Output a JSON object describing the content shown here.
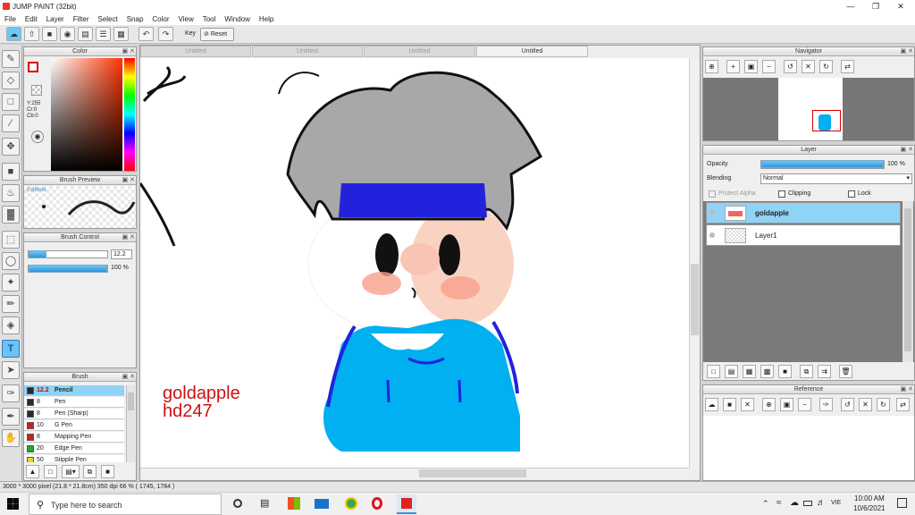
{
  "window": {
    "title": "JUMP PAINT (32bit)"
  },
  "menu": [
    "File",
    "Edit",
    "Layer",
    "Filter",
    "Select",
    "Snap",
    "Color",
    "View",
    "Tool",
    "Window",
    "Help"
  ],
  "toolbar": {
    "key_label": "Key",
    "reset_label": "Reset"
  },
  "color_panel": {
    "title": "Color",
    "values": [
      "Y:255",
      "Cr:0",
      "Cb:0"
    ]
  },
  "brush_preview": {
    "title": "Brush Preview",
    "size": "0.89mm"
  },
  "brush_control": {
    "title": "Brush Control",
    "size_value": "12.2",
    "opacity_value": "100 %"
  },
  "brush_panel": {
    "title": "Brush",
    "items": [
      {
        "size": "12.2",
        "name": "Pencil",
        "color": "#2a2a2a",
        "selected": true
      },
      {
        "size": "8",
        "name": "Pen",
        "color": "#2a2a2a"
      },
      {
        "size": "8",
        "name": "Pen (Sharp)",
        "color": "#2a2a2a"
      },
      {
        "size": "10",
        "name": "G Pen",
        "color": "#cc2020"
      },
      {
        "size": "8",
        "name": "Mapping Pen",
        "color": "#cc2020"
      },
      {
        "size": "20",
        "name": "Edge Pen",
        "color": "#22aa22"
      },
      {
        "size": "50",
        "name": "Stipple Pen",
        "color": "#dddd22"
      }
    ]
  },
  "tabs": [
    "Untitled",
    "Untitled",
    "Untitled",
    "Untitled"
  ],
  "canvas": {
    "signature_line1": "goldapple",
    "signature_line2": "hd247"
  },
  "navigator": {
    "title": "Navigator"
  },
  "layer_panel": {
    "title": "Layer",
    "opacity_label": "Opacity",
    "opacity_value": "100 %",
    "blending_label": "Blending",
    "blending_value": "Normal",
    "protect_alpha": "Protect Alpha",
    "clipping": "Clipping",
    "lock": "Lock",
    "layers": [
      {
        "name": "goldapple",
        "selected": true
      },
      {
        "name": "Layer1",
        "selected": false
      }
    ]
  },
  "reference": {
    "title": "Reference"
  },
  "status": "3000 * 3000 pixel  (21.8 * 21.8cm)  350 dpi  66 %  ( 1745, 1784 )",
  "taskbar": {
    "search_placeholder": "Type here to search",
    "lang": "VIE",
    "time": "10:00 AM",
    "date": "10/6/2021"
  },
  "colors": {
    "accent": "#6cc7f7",
    "signature": "#cc1111",
    "shirt": "#00b0f0",
    "headband": "#2222dd"
  }
}
